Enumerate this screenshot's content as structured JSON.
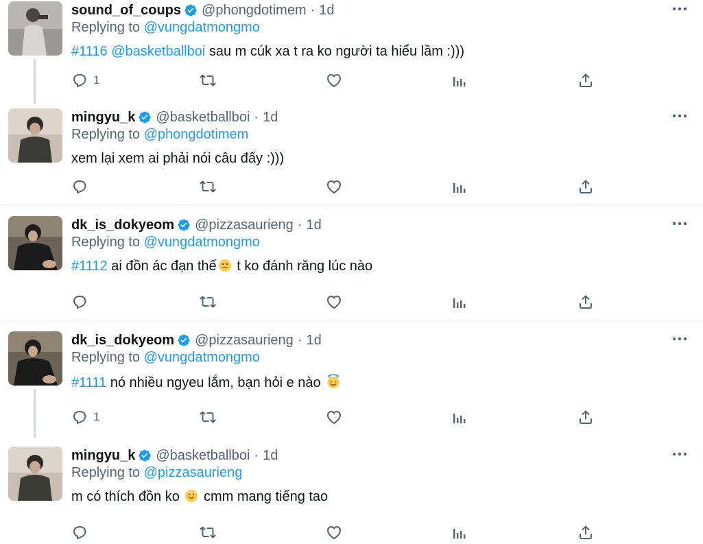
{
  "tweets": [
    {
      "name": "sound_of_coups",
      "handle": "@phongdotimem",
      "dot": "·",
      "time": "1d",
      "reply_prefix": "Replying to",
      "reply_to": "@vungdatmongmo",
      "hashtag": "#1116",
      "mention": "@basketballboi",
      "text": " sau m cúk xa t ra ko người ta hiểu lầm  :)))",
      "reply_count": "1",
      "avatar_icon": "avatar-photo"
    },
    {
      "name": "mingyu_k",
      "handle": "@basketballboi",
      "dot": "·",
      "time": "1d",
      "reply_prefix": "Replying to",
      "reply_to": "@phongdotimem",
      "text": "xem lại xem ai phải nói câu đấy :)))",
      "reply_count": "",
      "avatar_icon": "avatar-photo"
    },
    {
      "name": "dk_is_dokyeom",
      "handle": "@pizzasaurieng",
      "dot": "·",
      "time": "1d",
      "reply_prefix": "Replying to",
      "reply_to": "@vungdatmongmo",
      "hashtag": "#1112",
      "text_a": " ai đồn ác đạn thế",
      "text_b": "  t ko đánh răng lúc nào",
      "reply_count": "",
      "avatar_icon": "avatar-photo"
    },
    {
      "name": "dk_is_dokyeom",
      "handle": "@pizzasaurieng",
      "dot": "·",
      "time": "1d",
      "reply_prefix": "Replying to",
      "reply_to": "@vungdatmongmo",
      "hashtag": "#1111",
      "text_a": " nó nhiều ngyeu lắm, bạn hỏi e nào ",
      "reply_count": "1",
      "avatar_icon": "avatar-photo"
    },
    {
      "name": "mingyu_k",
      "handle": "@basketballboi",
      "dot": "·",
      "time": "1d",
      "reply_prefix": "Replying to",
      "reply_to": "@pizzasaurieng",
      "text_a": "m có thích đồn ko ",
      "text_b": " cmm mang tiếng tao",
      "reply_count": "",
      "avatar_icon": "avatar-photo"
    }
  ],
  "icons": {
    "verified": "verified-badge-icon",
    "more": "more-options-icon",
    "reply": "reply-icon",
    "retweet": "retweet-icon",
    "like": "like-icon",
    "views": "views-icon",
    "share": "share-icon",
    "emoji_slight_smile": "slightly-smiling-face-emoji",
    "emoji_halo": "smiling-face-with-halo-emoji"
  },
  "colors": {
    "link": "#1d9bf0",
    "secondary": "#536471",
    "text": "#0f1419",
    "verified": "#1d9bf0",
    "separator": "#e8ecef",
    "thread_line": "#cfd9de"
  }
}
